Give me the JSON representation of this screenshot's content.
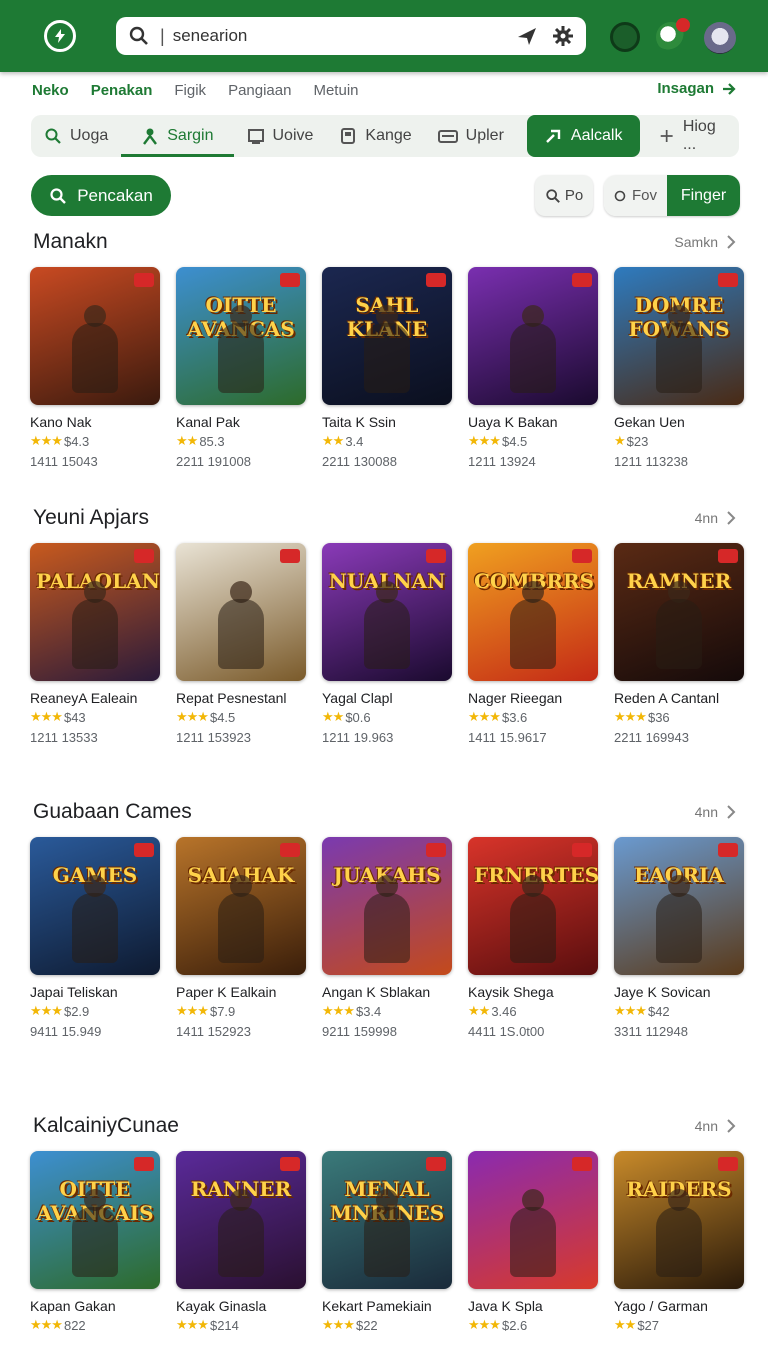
{
  "header": {
    "search_value": "senearion",
    "icons": [
      "logo-icon",
      "search-icon",
      "send-icon",
      "gear-icon",
      "game-controller-icon",
      "gift-icon",
      "avatar-icon"
    ]
  },
  "nav": {
    "items": [
      "Neko",
      "Penakan",
      "Figik",
      "Pangiaan",
      "Metuin"
    ],
    "active": [
      "Neko",
      "Penakan"
    ],
    "right_label": "Insagan"
  },
  "tabs": [
    {
      "label": "Uoga",
      "icon": "search-icon",
      "state": "normal"
    },
    {
      "label": "Sargin",
      "icon": "person-icon",
      "state": "selected"
    },
    {
      "label": "Uoive",
      "icon": "monitor-icon",
      "state": "normal"
    },
    {
      "label": "Kange",
      "icon": "device-icon",
      "state": "normal"
    },
    {
      "label": "Upler",
      "icon": "card-icon",
      "state": "normal"
    },
    {
      "label": "Aalcalk",
      "icon": "trend-icon",
      "state": "primary"
    },
    {
      "label": "Hiog ...",
      "icon": "plus-icon",
      "state": "normal"
    }
  ],
  "filters": {
    "primary_pill": "Pencakan",
    "chip_search": "Po",
    "seg_left": "Fov",
    "seg_right": "Finger"
  },
  "colors": {
    "brand": "#1e7a34",
    "star": "#f2b707",
    "badge": "#d62828"
  },
  "sections": [
    {
      "title": "Manakn",
      "more": "Samkn",
      "cards": [
        {
          "name": "Kano Nak",
          "stars": "★★★",
          "price": "$4.3",
          "downloads": "1411 15043",
          "art_text": "",
          "colors": [
            "#c94a22",
            "#3a1a0e"
          ]
        },
        {
          "name": "Kanal Pak",
          "stars": "★★",
          "price": "85.3",
          "downloads": "2211 191008",
          "art_text": "OITTE AVANCAS",
          "colors": [
            "#3d8fd1",
            "#2d6b2a"
          ]
        },
        {
          "name": "Taita K Ssin",
          "stars": "★★",
          "price": "3.4",
          "downloads": "2211 130088",
          "art_text": "SAHL KLANE",
          "colors": [
            "#1b2750",
            "#0b0f1e"
          ]
        },
        {
          "name": "Uaya K Bakan",
          "stars": "★★★",
          "price": "$4.5",
          "downloads": "1211 13924",
          "art_text": "",
          "colors": [
            "#7a2fb0",
            "#1a0a2e"
          ]
        },
        {
          "name": "Gekan Uen",
          "stars": "★",
          "price": "$23",
          "downloads": "1211 113238",
          "art_text": "DOMRE FOWANS",
          "colors": [
            "#2e7bbf",
            "#4a2a14"
          ]
        }
      ]
    },
    {
      "title": "Yeuni Apjars",
      "more": "4nn",
      "cards": [
        {
          "name": "ReaneyA Ealeain",
          "stars": "★★★",
          "price": "$43",
          "downloads": "1211 13533",
          "art_text": "PALAOLAN",
          "colors": [
            "#c85a1e",
            "#2a1a3a"
          ]
        },
        {
          "name": "Repat Pesnestanl",
          "stars": "★★★",
          "price": "$4.5",
          "downloads": "1211 153923",
          "art_text": "",
          "colors": [
            "#e9e3d5",
            "#7a5a2a"
          ]
        },
        {
          "name": "Yagal Clapl",
          "stars": "★★",
          "price": "$0.6",
          "downloads": "1211 19.963",
          "art_text": "NUALNAN",
          "colors": [
            "#8a3ab8",
            "#1a0a2e"
          ]
        },
        {
          "name": "Nager Rieegan",
          "stars": "★★★",
          "price": "$3.6",
          "downloads": "1411 15.9617",
          "art_text": "COMBRRS",
          "colors": [
            "#f0a020",
            "#c42a16"
          ]
        },
        {
          "name": "Reden A Cantanl",
          "stars": "★★★",
          "price": "$36",
          "downloads": "2211 169943",
          "art_text": "RAMNER",
          "colors": [
            "#5a2a14",
            "#150a0a"
          ]
        }
      ]
    },
    {
      "title": "Guabaan Cames",
      "more": "4nn",
      "cards": [
        {
          "name": "Japai Teliskan",
          "stars": "★★★",
          "price": "$2.9",
          "downloads": "9411 15.949",
          "art_text": "GAMES",
          "colors": [
            "#2a5a9a",
            "#0e1a30"
          ]
        },
        {
          "name": "Paper K Ealkain",
          "stars": "★★★",
          "price": "$7.9",
          "downloads": "1411 152923",
          "art_text": "SAIAHAK",
          "colors": [
            "#b8742a",
            "#3a1e0a"
          ]
        },
        {
          "name": "Angan K Sblakan",
          "stars": "★★★",
          "price": "$3.4",
          "downloads": "9211 159998",
          "art_text": "JUAKAHS",
          "colors": [
            "#7a3ab0",
            "#c44a1a"
          ]
        },
        {
          "name": "Kaysik Shega",
          "stars": "★★",
          "price": "3.46",
          "downloads": "4411 1S.0t00",
          "art_text": "FRNERTES",
          "colors": [
            "#d8342a",
            "#5a0e0e"
          ]
        },
        {
          "name": "Jaye K Sovican",
          "stars": "★★★",
          "price": "$42",
          "downloads": "3311 112948",
          "art_text": "EAORIA",
          "colors": [
            "#6a9ad0",
            "#5a3a1a"
          ]
        }
      ]
    },
    {
      "title": "KalcainiyCunae",
      "more": "4nn",
      "cards": [
        {
          "name": "Kapan Gakan",
          "stars": "★★★",
          "price": "822",
          "downloads": "",
          "art_text": "OITTE AVANCAIS",
          "colors": [
            "#3d8fd1",
            "#2d6b2a"
          ]
        },
        {
          "name": "Kayak Ginasla",
          "stars": "★★★",
          "price": "$214",
          "downloads": "",
          "art_text": "RANNER",
          "colors": [
            "#5a2a9a",
            "#2a1030"
          ]
        },
        {
          "name": "Kekart Pamekiain",
          "stars": "★★★",
          "price": "$22",
          "downloads": "",
          "art_text": "MENAL MNRINES",
          "colors": [
            "#3a7a7a",
            "#1a2a3a"
          ]
        },
        {
          "name": "Java K Spla",
          "stars": "★★★",
          "price": "$2.6",
          "downloads": "",
          "art_text": "",
          "colors": [
            "#8a2ab0",
            "#d83a2a"
          ]
        },
        {
          "name": "Yago / Garman",
          "stars": "★★",
          "price": "$27",
          "downloads": "",
          "art_text": "RAIDERS",
          "colors": [
            "#c88a2a",
            "#2a1a0a"
          ]
        }
      ]
    }
  ]
}
